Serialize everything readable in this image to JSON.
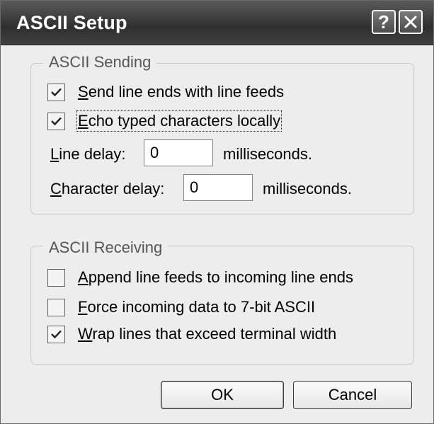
{
  "window": {
    "title": "ASCII Setup",
    "help_label": "?"
  },
  "sending": {
    "legend": "ASCII Sending",
    "send_line_ends": {
      "label_key": "S",
      "label_rest": "end line ends with line feeds",
      "checked": true
    },
    "echo_typed": {
      "label_key": "E",
      "label_rest": "cho typed characters locally",
      "checked": true,
      "focused": true
    },
    "line_delay": {
      "label_key": "L",
      "label_rest": "ine delay:",
      "value": "0",
      "unit": "milliseconds."
    },
    "char_delay": {
      "label_key": "C",
      "label_rest": "haracter delay:",
      "value": "0",
      "unit": "milliseconds."
    }
  },
  "receiving": {
    "legend": "ASCII Receiving",
    "append_line_feeds": {
      "label_key": "A",
      "label_rest": "ppend line feeds to incoming line ends",
      "checked": false
    },
    "force_7bit": {
      "label_key": "F",
      "label_rest": "orce incoming data to 7-bit ASCII",
      "checked": false
    },
    "wrap_lines": {
      "label_key": "W",
      "label_rest": "rap lines that exceed terminal width",
      "checked": true
    }
  },
  "buttons": {
    "ok_label": "OK",
    "cancel_label": "Cancel"
  },
  "icons": {
    "check": "check-icon",
    "close": "close-icon",
    "help": "help-icon"
  }
}
